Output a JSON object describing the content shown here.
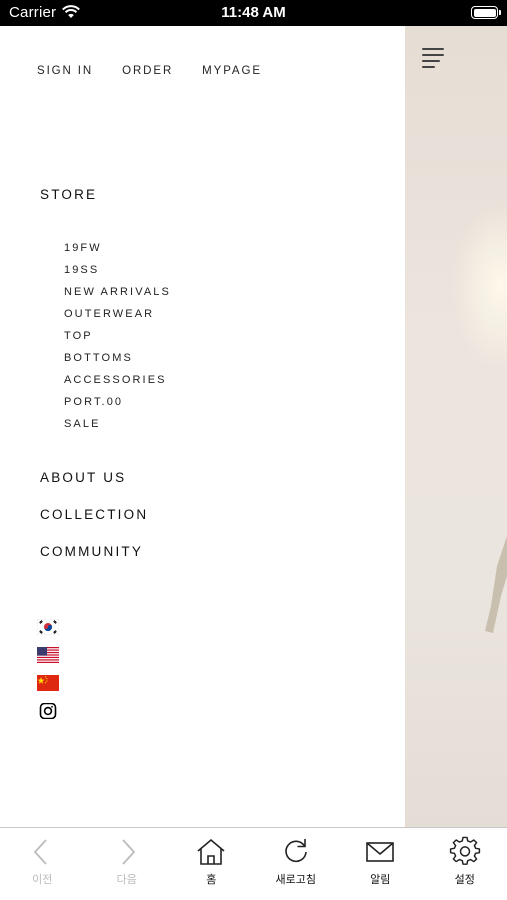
{
  "status_bar": {
    "carrier": "Carrier",
    "time": "11:48 AM"
  },
  "top_links": [
    "SIGN IN",
    "ORDER",
    "MYPAGE"
  ],
  "store_label": "STORE",
  "store_items": [
    "19FW",
    "19SS",
    "NEW ARRIVALS",
    "OUTERWEAR",
    "TOP",
    "BOTTOMS",
    "ACCESSORIES",
    "PORT.00",
    "SALE"
  ],
  "menu": {
    "about": "ABOUT US",
    "collection": "COLLECTION",
    "community": "COMMUNITY"
  },
  "icons": [
    "korea-flag-icon",
    "usa-flag-icon",
    "china-flag-icon",
    "instagram-icon"
  ],
  "toolbar": {
    "back": "이전",
    "forward": "다음",
    "home": "홈",
    "refresh": "새로고침",
    "notify": "알림",
    "settings": "설정"
  }
}
